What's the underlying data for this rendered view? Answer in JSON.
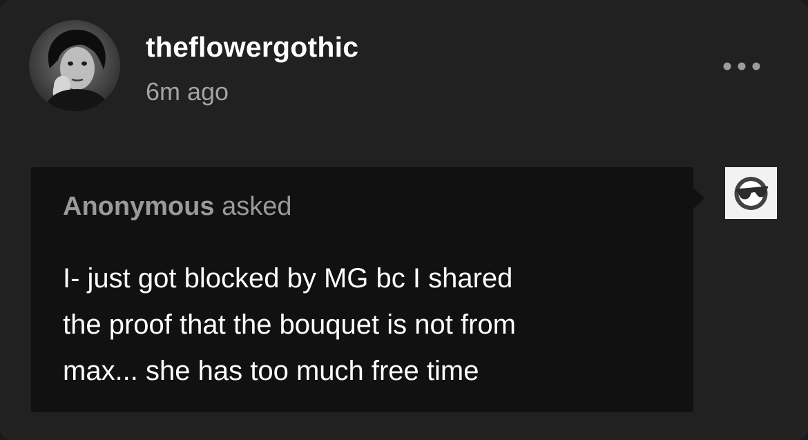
{
  "post": {
    "username": "theflowergothic",
    "timestamp": "6m ago"
  },
  "ask": {
    "asker_name": "Anonymous",
    "asker_verb": "asked",
    "question": "I- just got blocked by MG bc I shared\nthe proof that the bouquet is not from\nmax... she has too much free time"
  },
  "icons": {
    "post_menu": "ellipsis-icon",
    "anon_avatar": "sunglasses-face-icon"
  },
  "colors": {
    "background": "#212121",
    "ask_box": "#111111",
    "username": "#ffffff",
    "secondary_text": "#a3a3a3",
    "asker_text": "#9a9a9a"
  }
}
